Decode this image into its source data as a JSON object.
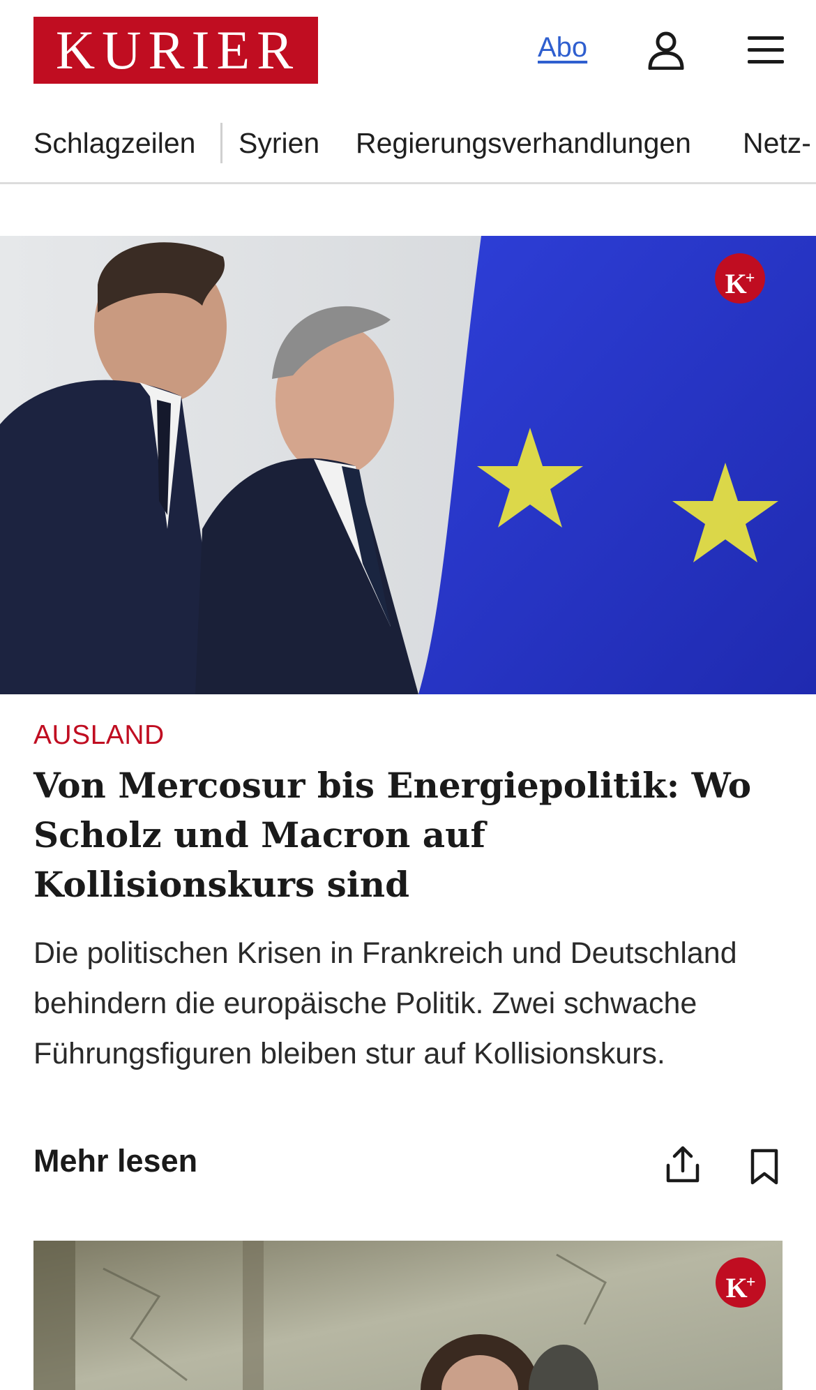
{
  "header": {
    "logo_text": "KURIER",
    "abo_label": "Abo",
    "user_icon": "user-icon",
    "menu_icon": "hamburger-menu-icon"
  },
  "nav": {
    "items": [
      {
        "label": "Schlagzeilen"
      },
      {
        "label": "Syrien"
      },
      {
        "label": "Regierungsverhandlungen"
      },
      {
        "label": "Netz-"
      }
    ]
  },
  "articles": [
    {
      "premium_badge": "K+",
      "image_alt": "Macron und Scholz vor EU-Flagge",
      "kicker": "AUSLAND",
      "headline": "Von Mercosur bis Energiepolitik: Wo Scholz und Macron auf Kollisionskurs sind",
      "teaser": "Die politischen Krisen in Frankreich und Deutschland behindern die europäische Politik. Zwei schwache Führungsfiguren bleiben stur auf Kollisionskurs.",
      "more_label": "Mehr lesen",
      "share_icon": "share-icon",
      "bookmark_icon": "bookmark-icon"
    },
    {
      "premium_badge": "K+"
    }
  ],
  "colors": {
    "brand_red": "#c00d21",
    "link_blue": "#2f5fcf",
    "eu_blue": "#2a35c8",
    "eu_star": "#f0ea3c"
  }
}
